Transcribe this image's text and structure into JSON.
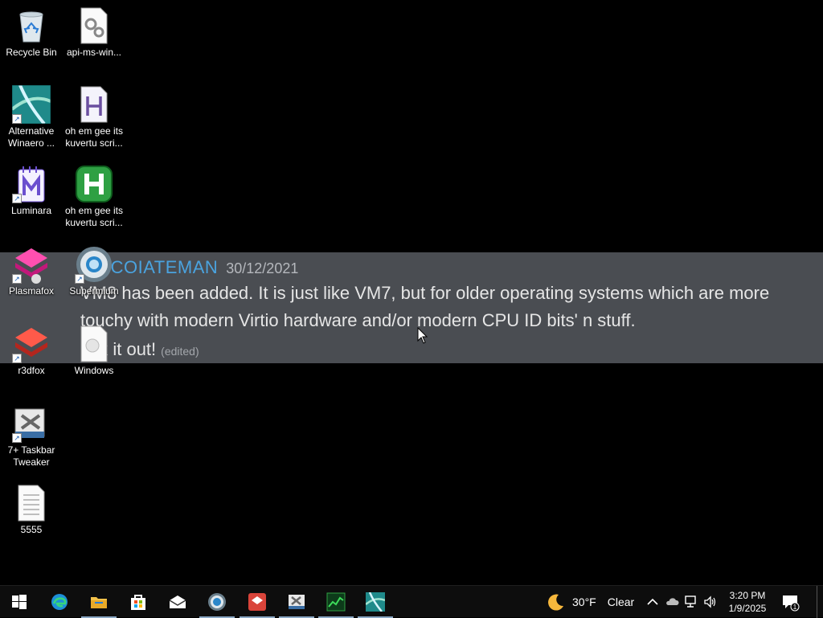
{
  "desktop_icons": {
    "recycle_bin": "Recycle Bin",
    "api_ms_win": "api-ms-win...",
    "alternative_winaero": "Alternative Winaero ...",
    "oh_em_gee_1": "oh em gee its kuvertu scri...",
    "luminara": "Luminara",
    "oh_em_gee_2": "oh em gee its kuvertu scri...",
    "plasmafox": "Plasmafox",
    "supermium": "Supermium",
    "r3dfox": "r3dfox",
    "windows": "Windows",
    "taskbar_tweaker": "7+ Taskbar Tweaker",
    "file_5555": "5555"
  },
  "message": {
    "author": "OCOIATEMAN",
    "date": "30/12/2021",
    "line1": "VM8 has been added. It is just like VM7, but for older operating systems which are more",
    "line2": "touchy with modern Virtio hardware and/or modern CPU ID bits' n stuff.",
    "line3": "eck it out!",
    "edited": "(edited)"
  },
  "taskbar": {
    "weather_temp": "30°F",
    "weather_text": "Clear",
    "time": "3:20 PM",
    "date": "1/9/2025",
    "notification_count": "1",
    "pinned": [
      "start",
      "edge",
      "file-explorer",
      "store",
      "mail",
      "supermium",
      "r3dfox",
      "taskbar-tweaker",
      "task-manager",
      "winaero"
    ]
  },
  "colors": {
    "banner_bg": "#4a4d52",
    "author": "#4aa3df",
    "taskbar_bg": "#0d0d0d"
  }
}
